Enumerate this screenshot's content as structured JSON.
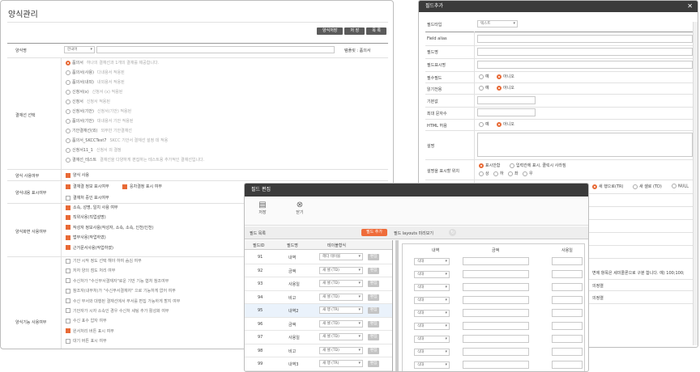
{
  "left": {
    "title": "양식관리",
    "buttons": [
      "양식저장",
      "저 장",
      "목 록"
    ],
    "name_label": "양식명",
    "lang_value": "한국어",
    "category_label": "템플릿 : 품의서",
    "section_result": "결재선 선택",
    "radio_items": [
      {
        "label": "품의서",
        "desc": "하나의 결재선과 1개의 결재를 제공합니다."
      },
      {
        "label": "품의서(사용)",
        "desc": "다내용서 적용된"
      },
      {
        "label": "품의서(내외)",
        "desc": "내외용서 적용된"
      },
      {
        "label": "신청서(x)",
        "desc": "신청서 (x) 적용된"
      },
      {
        "label": "신청서",
        "desc": "신청서 적용된"
      },
      {
        "label": "신청서(기안)",
        "desc": "신청서(기안) 적용된"
      },
      {
        "label": "품의서(기안)",
        "desc": "대내용서 기안 적용된"
      },
      {
        "label": "기안결재선(외)",
        "desc": "외부만 기안결재선"
      },
      {
        "label": "품의서_SKCCTest7",
        "desc": "SKCC 기안서 결재선 설정 데 적용"
      },
      {
        "label": "신청서11_1",
        "desc": "신청서 의 결정"
      },
      {
        "label": "결재선_테스트",
        "desc": "결재선을 다양하게 편집하는 테스트용 추가적인 결재선입니다."
      }
    ],
    "section_use": "양식 사용여부",
    "use_label": "양식 사용",
    "section_content": "양식내용 표시여부",
    "content_items": [
      "결재결 정보 표시여부",
      "응차결정 표시 여부",
      "결재처 중인 표시여부"
    ],
    "section_login": "양식화면 사용여부",
    "login_items": [
      "소속, 성명, 일치 사용 여부",
      "직위사용(직업설명)",
      "작성자 정보사용(작성자, 소속, 소속, 인천/인천)",
      "법부사용(작업하였)",
      "근거문서사용(작업하였)"
    ],
    "section_func": "양식기능 사용여부",
    "func_items": [
      "기안 시작 정도 선택 해야 하여 숨김 여부",
      "저자 양의 점도 처리 여부",
      "수신처가 \"수신부서결재자\"로운 기만 기능 협처 참조여부",
      "참조자(내부처)가 \"수신부서결재자\" 으로 기능하게 없어 여부",
      "수신 부서와 대행된 결재선에서 부서를 편집 가능하게 할지 여부",
      "기안자가 시자 소속인 경우 수신처 세팅 추가 활성화 여부",
      "수신 표수 압자 여부",
      "원서처리 버튼 표시 여부",
      "대기 버튼 표시 여부"
    ]
  },
  "fieldadd": {
    "title": "필드추가",
    "type_label": "필드타입",
    "type_value": "텍스트",
    "rows": [
      "Field alias",
      "필드명",
      "필드표시명"
    ],
    "required_label": "필수필드",
    "readonly_label": "읽기전용",
    "yes": "예",
    "no": "아니오",
    "default_label": "기본값",
    "maxlen_label": "최대 문자수",
    "html_label": "HTML 허용",
    "desc_label": "설명",
    "pos_label": "설명을 표시할 위치",
    "pos_options": [
      "표시안함",
      "입력칸에 표시, 클릭시 사라짐",
      "상",
      "하",
      "좌",
      "우"
    ],
    "row_options": [
      "새 행으로(TR)",
      "새 셀로 (TD)",
      "NULL"
    ],
    "note1": "변에 항목은 세미콜론으로 구분 합니다. 예) 100;100;",
    "note2": "의정렬",
    "note3": "의정렬"
  },
  "fieldedit": {
    "title": "필드 편집",
    "save_label": "저장",
    "close_label": "닫기",
    "list_label": "필드 목록",
    "add_btn": "필드 추가",
    "preview_label": "필드 layouts 미리보기",
    "headers": [
      "필드ID",
      "필드명",
      "테이블형식"
    ],
    "edit_btn": "편집",
    "rows": [
      {
        "id": "91",
        "name": "내역",
        "fmt": "헤더 테이블"
      },
      {
        "id": "92",
        "name": "금액",
        "fmt": "새 셀 (TD)"
      },
      {
        "id": "93",
        "name": "사용일",
        "fmt": "새 셀 (TD)"
      },
      {
        "id": "94",
        "name": "비고",
        "fmt": "새 셀 (TD)"
      },
      {
        "id": "95",
        "name": "내역2",
        "fmt": "새 행 (TR)"
      },
      {
        "id": "96",
        "name": "금액",
        "fmt": "새 셀 (TD)"
      },
      {
        "id": "97",
        "name": "사용일",
        "fmt": "새 셀 (TD)"
      },
      {
        "id": "98",
        "name": "비고",
        "fmt": "새 셀 (TD)"
      },
      {
        "id": "99",
        "name": "내역3",
        "fmt": "새 행 (TR)"
      }
    ],
    "preview_headers": [
      "내역",
      "금액",
      "사용일"
    ],
    "preview_select": "식대"
  }
}
